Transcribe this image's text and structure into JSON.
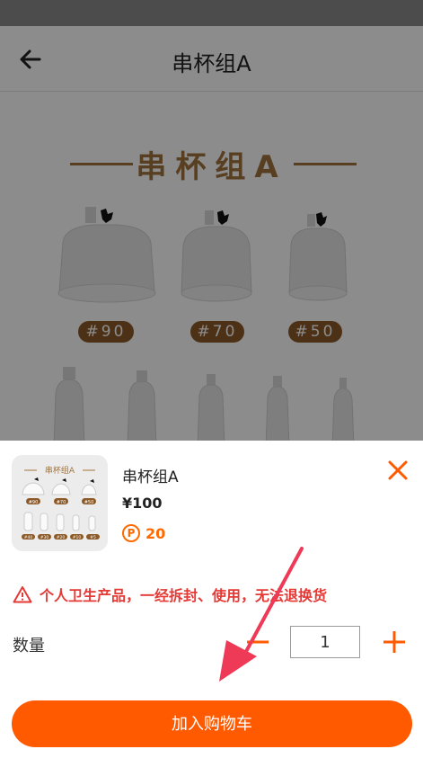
{
  "header": {
    "title": "串杯组A",
    "back_icon": "back-arrow-icon"
  },
  "hero": {
    "title": "串杯组A",
    "brand_color": "#a2733c"
  },
  "cups": [
    {
      "label": "#90"
    },
    {
      "label": "#70"
    },
    {
      "label": "#50"
    }
  ],
  "sheet": {
    "product_name": "串杯组A",
    "price": "¥100",
    "points_icon": "P",
    "points": "20",
    "close_icon": "close-icon",
    "warning_text": "个人卫生产品，一经拆封、使用，无法退换货",
    "quantity_label": "数量",
    "quantity_value": "1",
    "add_to_cart_label": "加入购物车",
    "accent_color": "#ff5a00"
  },
  "thumbnail": {
    "title": "串杯组A",
    "tags_top": [
      "#90",
      "#70",
      "#50"
    ],
    "tags_bottom": [
      "#40",
      "#30",
      "#20",
      "#10",
      "#5"
    ]
  }
}
